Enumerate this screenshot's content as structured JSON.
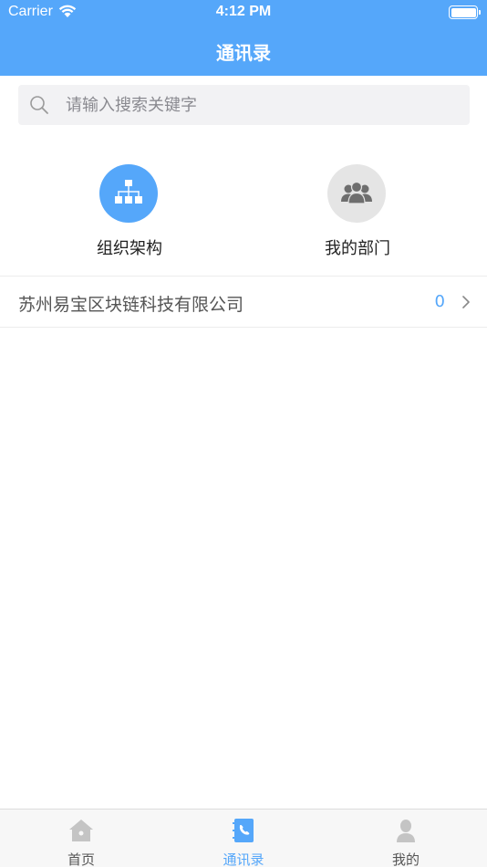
{
  "status_bar": {
    "carrier": "Carrier",
    "time": "4:12 PM"
  },
  "nav": {
    "title": "通讯录"
  },
  "search": {
    "placeholder": "请输入搜索关键字"
  },
  "quick_actions": [
    {
      "label": "组织架构",
      "icon": "org-chart-icon",
      "color": "#55a7fa"
    },
    {
      "label": "我的部门",
      "icon": "people-group-icon",
      "color": "#e5e5e5"
    }
  ],
  "company": {
    "name": "苏州易宝区块链科技有限公司",
    "count": "0"
  },
  "tabs": [
    {
      "label": "首页",
      "icon": "home-icon",
      "active": false
    },
    {
      "label": "通讯录",
      "icon": "contacts-book-icon",
      "active": true
    },
    {
      "label": "我的",
      "icon": "user-icon",
      "active": false
    }
  ],
  "colors": {
    "accent": "#55a7fa",
    "inactive_icon": "#c4c4c4",
    "background": "#ffffff"
  }
}
